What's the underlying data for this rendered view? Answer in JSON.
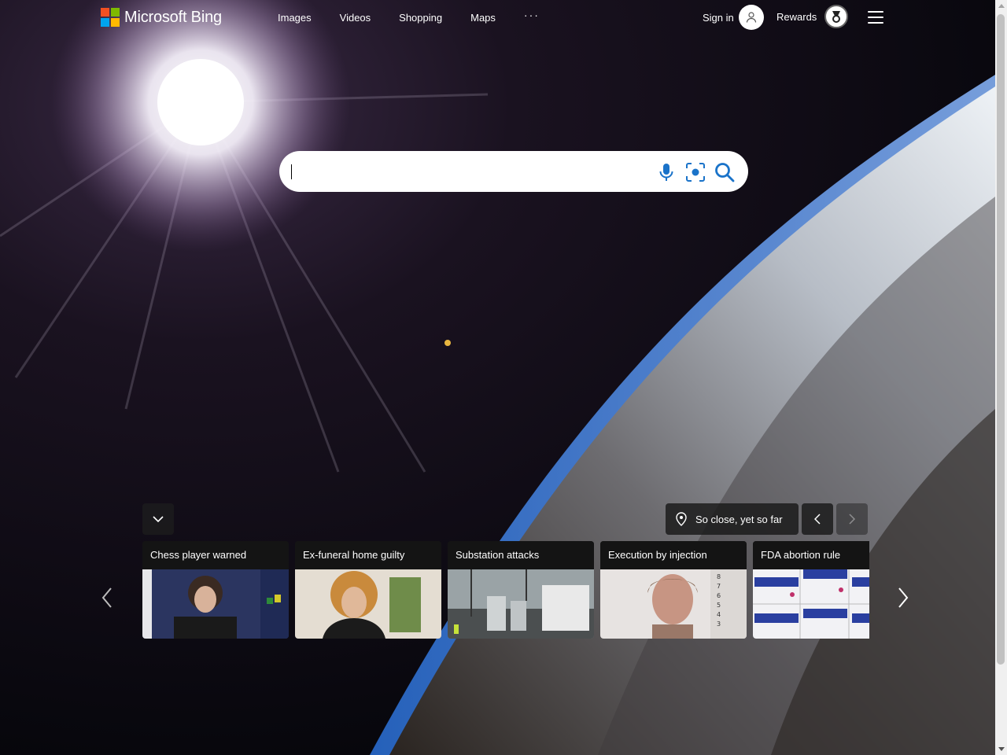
{
  "header": {
    "logo_text": "Microsoft Bing",
    "logo_colors": [
      "#f25022",
      "#7fba00",
      "#00a4ef",
      "#ffb900"
    ],
    "nav": [
      "Images",
      "Videos",
      "Shopping",
      "Maps",
      "···"
    ],
    "signin_label": "Sign in",
    "rewards_label": "Rewards"
  },
  "search": {
    "value": "",
    "icons": [
      "microphone-icon",
      "visual-search-icon",
      "search-icon"
    ]
  },
  "image_info": {
    "location_label": "So close, yet so far"
  },
  "news": {
    "cards": [
      {
        "title": "Chess player warned"
      },
      {
        "title": "Ex-funeral home guilty"
      },
      {
        "title": "Substation attacks"
      },
      {
        "title": "Execution by injection"
      },
      {
        "title": "FDA abortion rule"
      }
    ]
  },
  "colors": {
    "card_bar": "#141414",
    "accent": "#ffffff"
  }
}
